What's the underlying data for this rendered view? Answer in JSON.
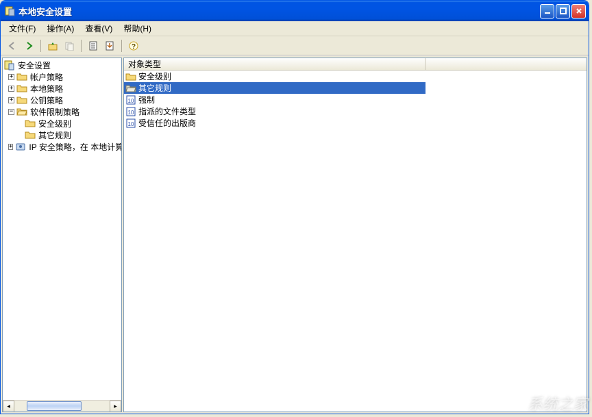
{
  "window": {
    "title": "本地安全设置"
  },
  "menu": {
    "file": "文件(F)",
    "action": "操作(A)",
    "view": "查看(V)",
    "help": "帮助(H)"
  },
  "toolbar": {
    "back": "后退",
    "forward": "前进",
    "up": "上一级",
    "copy": "复制",
    "properties": "属性",
    "export": "导出列表",
    "help": "帮助"
  },
  "tree": {
    "root": "安全设置",
    "items": [
      {
        "label": "帐户策略",
        "expandable": true,
        "expanded": false,
        "icon": "folder"
      },
      {
        "label": "本地策略",
        "expandable": true,
        "expanded": false,
        "icon": "folder"
      },
      {
        "label": "公钥策略",
        "expandable": true,
        "expanded": false,
        "icon": "folder"
      },
      {
        "label": "软件限制策略",
        "expandable": true,
        "expanded": true,
        "icon": "folder-open",
        "children": [
          {
            "label": "安全级别",
            "icon": "folder"
          },
          {
            "label": "其它规则",
            "icon": "folder"
          }
        ]
      },
      {
        "label": "IP 安全策略，在 本地计算机",
        "expandable": true,
        "expanded": false,
        "icon": "ipsec"
      }
    ]
  },
  "list": {
    "column_header": "对象类型",
    "rows": [
      {
        "label": "安全级别",
        "icon": "folder",
        "selected": false
      },
      {
        "label": "其它规则",
        "icon": "folder-open",
        "selected": true
      },
      {
        "label": "强制",
        "icon": "policy",
        "selected": false
      },
      {
        "label": "指派的文件类型",
        "icon": "policy",
        "selected": false
      },
      {
        "label": "受信任的出版商",
        "icon": "policy",
        "selected": false
      }
    ]
  },
  "watermark": "系统之家"
}
